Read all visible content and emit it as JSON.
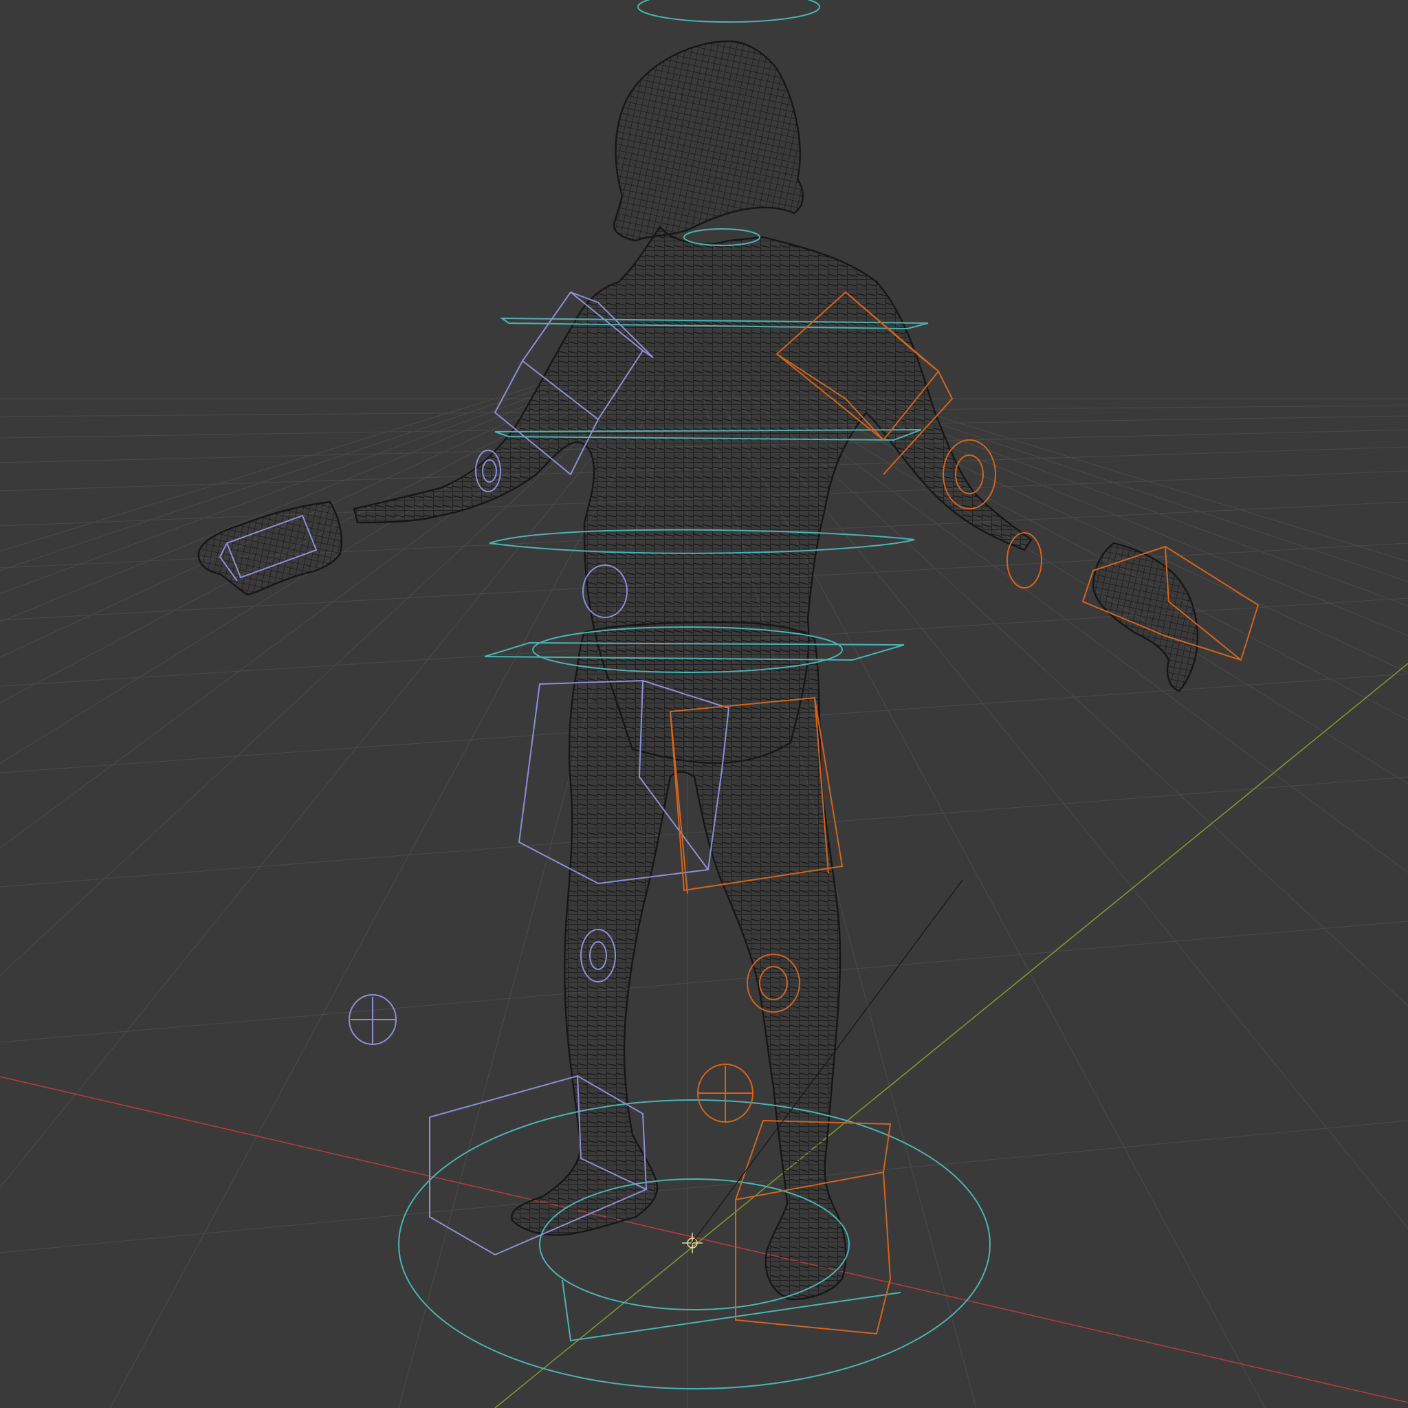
{
  "viewport": {
    "name": "3d-viewport",
    "shading": "wireframe",
    "subject": "character-rig-with-control-widgets"
  },
  "colors": {
    "background": "#3a3a3a",
    "grid": "#474747",
    "mesh_wire": "#1a1a1a",
    "axis_x": "#b23a3a",
    "axis_y": "#7a9a2a",
    "controls_root": "#4ab3b5",
    "controls_left": "#8b90d6",
    "controls_right": "#d3641c",
    "cursor": "#e8d8a0"
  }
}
